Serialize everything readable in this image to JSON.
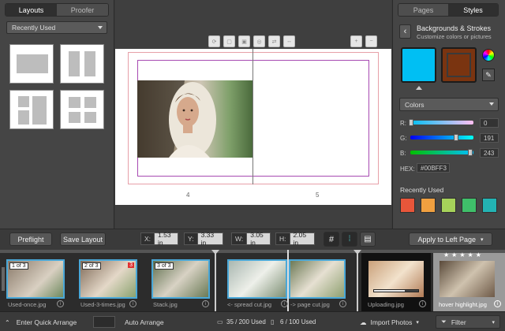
{
  "left_panel": {
    "tabs": [
      "Layouts",
      "Proofer"
    ],
    "active_tab": "Layouts",
    "filter_dropdown": "Recently Used"
  },
  "center": {
    "page_numbers": [
      "4",
      "5"
    ]
  },
  "right_panel": {
    "tabs": [
      "Pages",
      "Styles"
    ],
    "active_tab": "Styles",
    "section_title": "Backgrounds & Strokes",
    "section_subtitle": "Customize colors or pictures",
    "colors_dropdown": "Colors",
    "rgb": [
      {
        "label": "R:",
        "value": "0"
      },
      {
        "label": "G:",
        "value": "191"
      },
      {
        "label": "B:",
        "value": "243"
      }
    ],
    "hex_label": "HEX:",
    "hex_value": "#00BFF3",
    "recently_used_label": "Recently Used",
    "recent_colors": [
      "#e8563a",
      "#f0a040",
      "#a6d25a",
      "#3fbf6a",
      "#23b3b3"
    ],
    "fill_color": "#00BFF3",
    "stroke_color": "#7a3410"
  },
  "toolbar": {
    "preflight": "Preflight",
    "save_layout": "Save Layout",
    "x_label": "X:",
    "x_value": "1.53 in",
    "y_label": "Y:",
    "y_value": "3.33 in",
    "w_label": "W:",
    "w_value": "3.05 in",
    "h_label": "H:",
    "h_value": "2.05 in",
    "apply_button": "Apply to Left Page"
  },
  "filmstrip": [
    {
      "caption": "Used-once.jpg",
      "badge": "1 of 3"
    },
    {
      "caption": "Used-3-times.jpg",
      "badge": "2 of 3",
      "badge2": "3"
    },
    {
      "caption": "Stack.jpg",
      "badge": "3 of 3"
    },
    {
      "caption": "<- spread cut.jpg"
    },
    {
      "caption": "-> page cut.jpg"
    },
    {
      "caption": "Uploading.jpg"
    },
    {
      "caption": "hover highlight.jpg"
    }
  ],
  "bottom_bar": {
    "quick_arrange": "Enter Quick Arrange",
    "auto_arrange": "Auto Arrange",
    "spreads_used": "35 / 200 Used",
    "pages_used": "6 / 100 Used",
    "import": "Import Photos",
    "filter": "Filter"
  }
}
